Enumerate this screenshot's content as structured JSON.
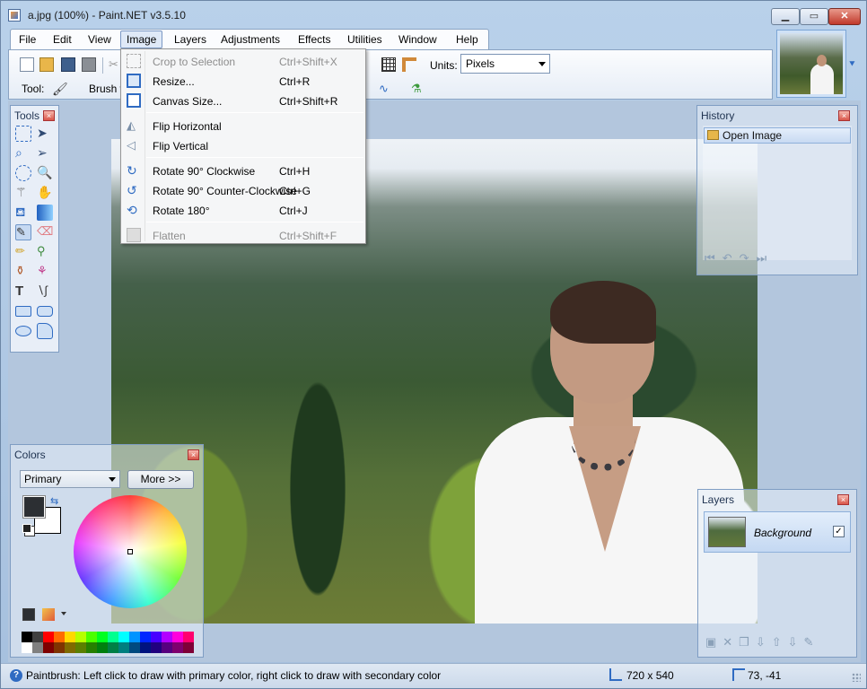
{
  "window": {
    "title": "a.jpg (100%) - Paint.NET v3.5.10",
    "min_label": "▁",
    "max_label": "▭",
    "close_label": "✕"
  },
  "menubar": {
    "items": [
      "File",
      "Edit",
      "View",
      "Image",
      "Layers",
      "Adjustments",
      "Effects",
      "Utilities",
      "Window",
      "Help"
    ],
    "active": "Image"
  },
  "toolbar": {
    "tool_label": "Tool:",
    "brush_label": "Brush w",
    "units_label": "Units:",
    "units_value": "Pixels"
  },
  "image_menu": [
    {
      "label": "Crop to Selection",
      "shortcut": "Ctrl+Shift+X",
      "icon": "crop-icon",
      "enabled": false
    },
    {
      "label": "Resize...",
      "shortcut": "Ctrl+R",
      "icon": "resize-icon",
      "enabled": true
    },
    {
      "label": "Canvas Size...",
      "shortcut": "Ctrl+Shift+R",
      "icon": "canvas-size-icon",
      "enabled": true
    },
    {
      "label": "Flip Horizontal",
      "shortcut": "",
      "icon": "flip-horizontal-icon",
      "enabled": true
    },
    {
      "label": "Flip Vertical",
      "shortcut": "",
      "icon": "flip-vertical-icon",
      "enabled": true
    },
    {
      "label": "Rotate 90° Clockwise",
      "shortcut": "Ctrl+H",
      "icon": "rotate-cw-icon",
      "enabled": true
    },
    {
      "label": "Rotate 90° Counter-Clockwise",
      "shortcut": "Ctrl+G",
      "icon": "rotate-ccw-icon",
      "enabled": true
    },
    {
      "label": "Rotate 180°",
      "shortcut": "Ctrl+J",
      "icon": "rotate-180-icon",
      "enabled": true
    },
    {
      "label": "Flatten",
      "shortcut": "Ctrl+Shift+F",
      "icon": "flatten-icon",
      "enabled": false
    }
  ],
  "tools_panel": {
    "title": "Tools",
    "close": "×"
  },
  "history_panel": {
    "title": "History",
    "close": "×",
    "items": [
      "Open Image"
    ],
    "buttons": "⏮↶↷⏭"
  },
  "colors_panel": {
    "title": "Colors",
    "close": "×",
    "primary_select": "Primary",
    "more_button": "More >>",
    "primary_color": "#2c2f33",
    "secondary_color": "#ffffff",
    "palette": [
      "#000000",
      "#404040",
      "#ff0000",
      "#ff6a00",
      "#ffd800",
      "#b6ff00",
      "#4cff00",
      "#00ff21",
      "#00ff90",
      "#00ffff",
      "#0094ff",
      "#0026ff",
      "#4800ff",
      "#b200ff",
      "#ff00dc",
      "#ff006e",
      "#ffffff",
      "#808080",
      "#7f0000",
      "#7f3300",
      "#7f6a00",
      "#5b7f00",
      "#267f00",
      "#007f0e",
      "#007f46",
      "#007f7f",
      "#004a7f",
      "#00137f",
      "#21007f",
      "#57007f",
      "#7f006e",
      "#7f0037"
    ]
  },
  "layers_panel": {
    "title": "Layers",
    "close": "×",
    "layers": [
      {
        "name": "Background",
        "visible": true
      }
    ],
    "buttons": "▣✕❐⇩⇧⇩✎"
  },
  "statusbar": {
    "help_text": "Paintbrush: Left click to draw with primary color, right click to draw with secondary color",
    "image_size": "720 x 540",
    "cursor_pos": "73, -41"
  }
}
